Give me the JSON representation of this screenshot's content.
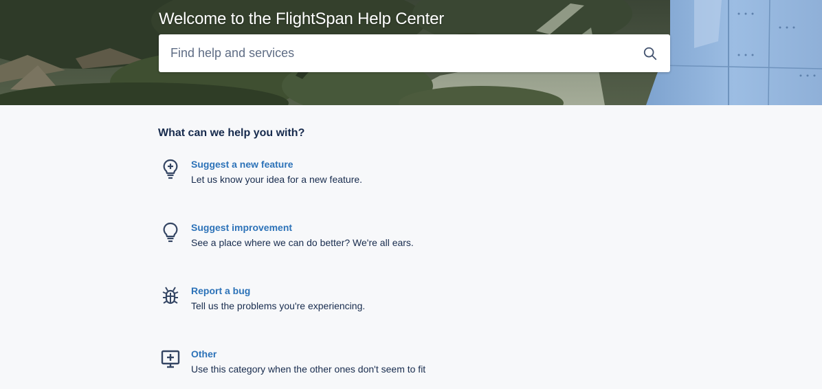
{
  "hero": {
    "title": "Welcome to the FlightSpan Help Center"
  },
  "search": {
    "placeholder": "Find help and services",
    "icon": "search-icon"
  },
  "main": {
    "heading": "What can we help you with?",
    "request_types": [
      {
        "title": "Suggest a new feature",
        "description": "Let us know your idea for a new feature.",
        "icon": "lightbulb-plus-icon"
      },
      {
        "title": "Suggest improvement",
        "description": "See a place where we can do better? We're all ears.",
        "icon": "lightbulb-icon"
      },
      {
        "title": "Report a bug",
        "description": "Tell us the problems you're experiencing.",
        "icon": "bug-icon"
      },
      {
        "title": "Other",
        "description": "Use this category when the other ones don't seem to fit",
        "icon": "monitor-plus-icon"
      }
    ]
  },
  "colors": {
    "link": "#2c72b8",
    "text": "#172b4d",
    "background": "#f7f8fa",
    "icon": "#344563"
  }
}
